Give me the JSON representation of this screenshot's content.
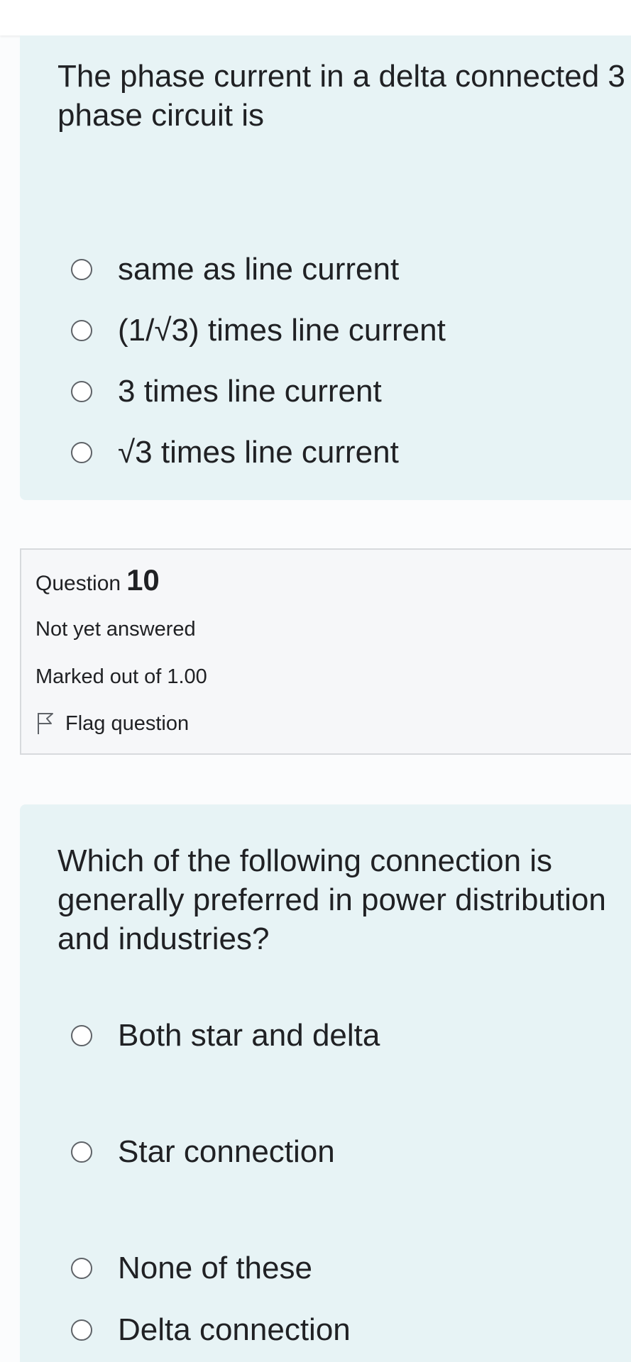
{
  "question_9": {
    "text": "The phase current in a delta connected 3 phase circuit is",
    "options": [
      {
        "label": "same as line current"
      },
      {
        "label": "(1/√3) times line current"
      },
      {
        "label": "3 times line current"
      },
      {
        "label": "√3 times line current"
      }
    ]
  },
  "question_10_info": {
    "heading_prefix": "Question",
    "number": "10",
    "state": "Not yet answered",
    "grade": "Marked out of 1.00",
    "flag_label": "Flag question",
    "flag_icon": "flag-outline-icon"
  },
  "question_10": {
    "text": "Which of the following connection  is generally preferred in power distribution and industries?",
    "options": [
      {
        "label": "Both star and delta"
      },
      {
        "label": "Star connection"
      },
      {
        "label": "None of these"
      },
      {
        "label": "Delta connection"
      }
    ]
  },
  "colors": {
    "question_panel_bg": "#e7f3f5",
    "info_panel_bg": "#f6f7f9",
    "info_border": "#d7dadd",
    "text": "#202124"
  }
}
